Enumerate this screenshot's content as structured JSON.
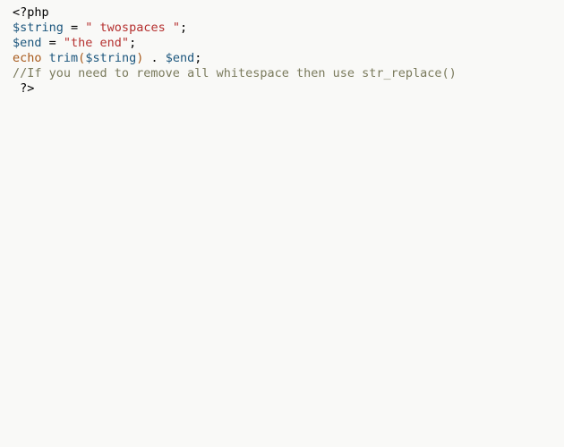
{
  "code": {
    "line1": {
      "open": "<?php"
    },
    "line2": {
      "var": "$string",
      "eq": " = ",
      "str": "\" twospaces \"",
      "semi": ";"
    },
    "line3": {
      "var": "$end",
      "eq": " = ",
      "str": "\"the end\"",
      "semi": ";"
    },
    "line4": {
      "echo": "echo",
      "sp1": " ",
      "trim": "trim",
      "lp": "(",
      "arg": "$string",
      "rp": ")",
      "sp2": " ",
      "dot": ".",
      "sp3": " ",
      "var2": "$end",
      "semi": ";"
    },
    "line5": {
      "comment": "//If you need to remove all whitespace then use str_replace()"
    },
    "line6": {
      "sp": " ",
      "close": "?>"
    }
  }
}
